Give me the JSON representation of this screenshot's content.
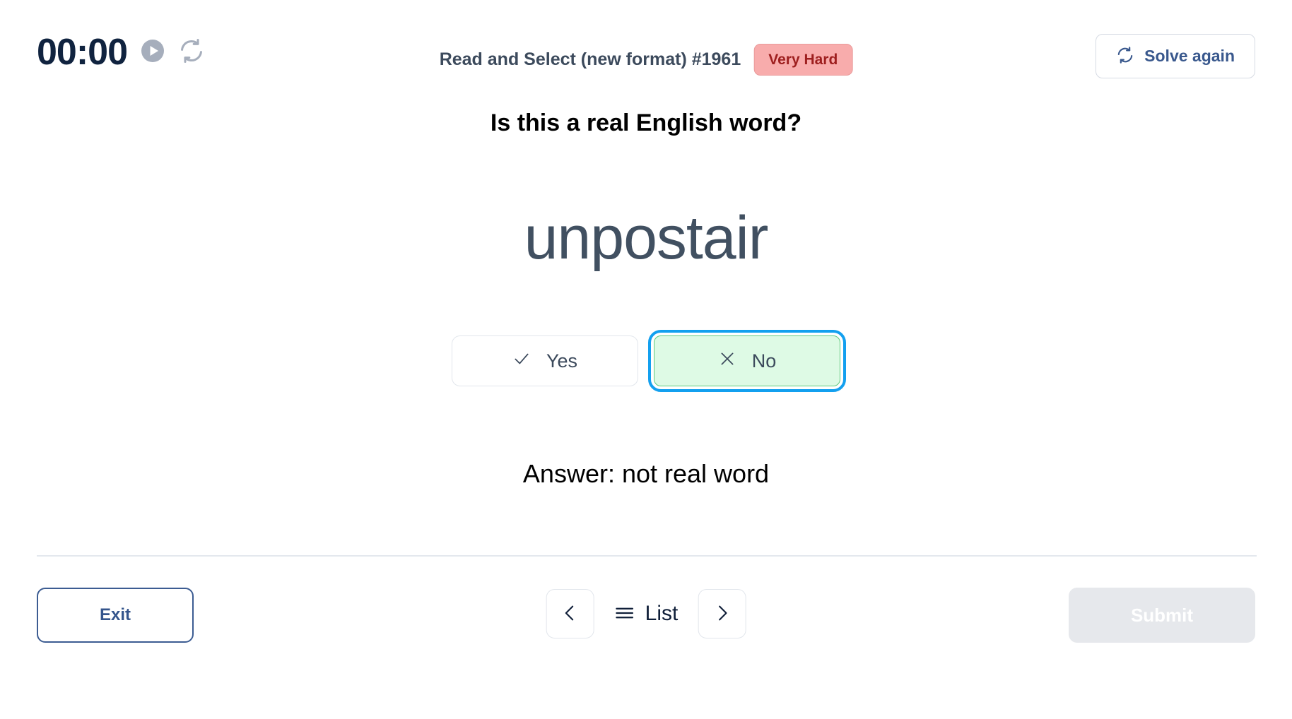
{
  "header": {
    "timer": "00:00",
    "play_icon": "play-circle-icon",
    "reset_icon": "reset-refresh-icon",
    "exercise_title": "Read and Select (new format) #1961",
    "difficulty": "Very Hard",
    "solve_again_label": "Solve again",
    "solve_again_icon": "refresh-sync-icon"
  },
  "main": {
    "question": "Is this a real English word?",
    "word": "unpostair",
    "choices": [
      {
        "label": "Yes",
        "icon": "check-icon",
        "selected": false
      },
      {
        "label": "No",
        "icon": "cross-icon",
        "selected": true
      }
    ],
    "answer": "Answer: not real word"
  },
  "footer": {
    "exit_label": "Exit",
    "prev_icon": "chevron-left-icon",
    "next_icon": "chevron-right-icon",
    "list_label": "List",
    "list_icon": "hamburger-menu-icon",
    "submit_label": "Submit"
  },
  "colors": {
    "navy": "#10233f",
    "slate": "#3c4a5c",
    "badge_bg": "#f8acac",
    "badge_text": "#9e1f1f",
    "link_blue": "#39588d",
    "selected_bg": "#defae5",
    "selected_border": "#5ec97c",
    "focus_ring": "#13a0ef",
    "disabled_bg": "#e6e8ec",
    "divider": "#e4e8ee"
  }
}
